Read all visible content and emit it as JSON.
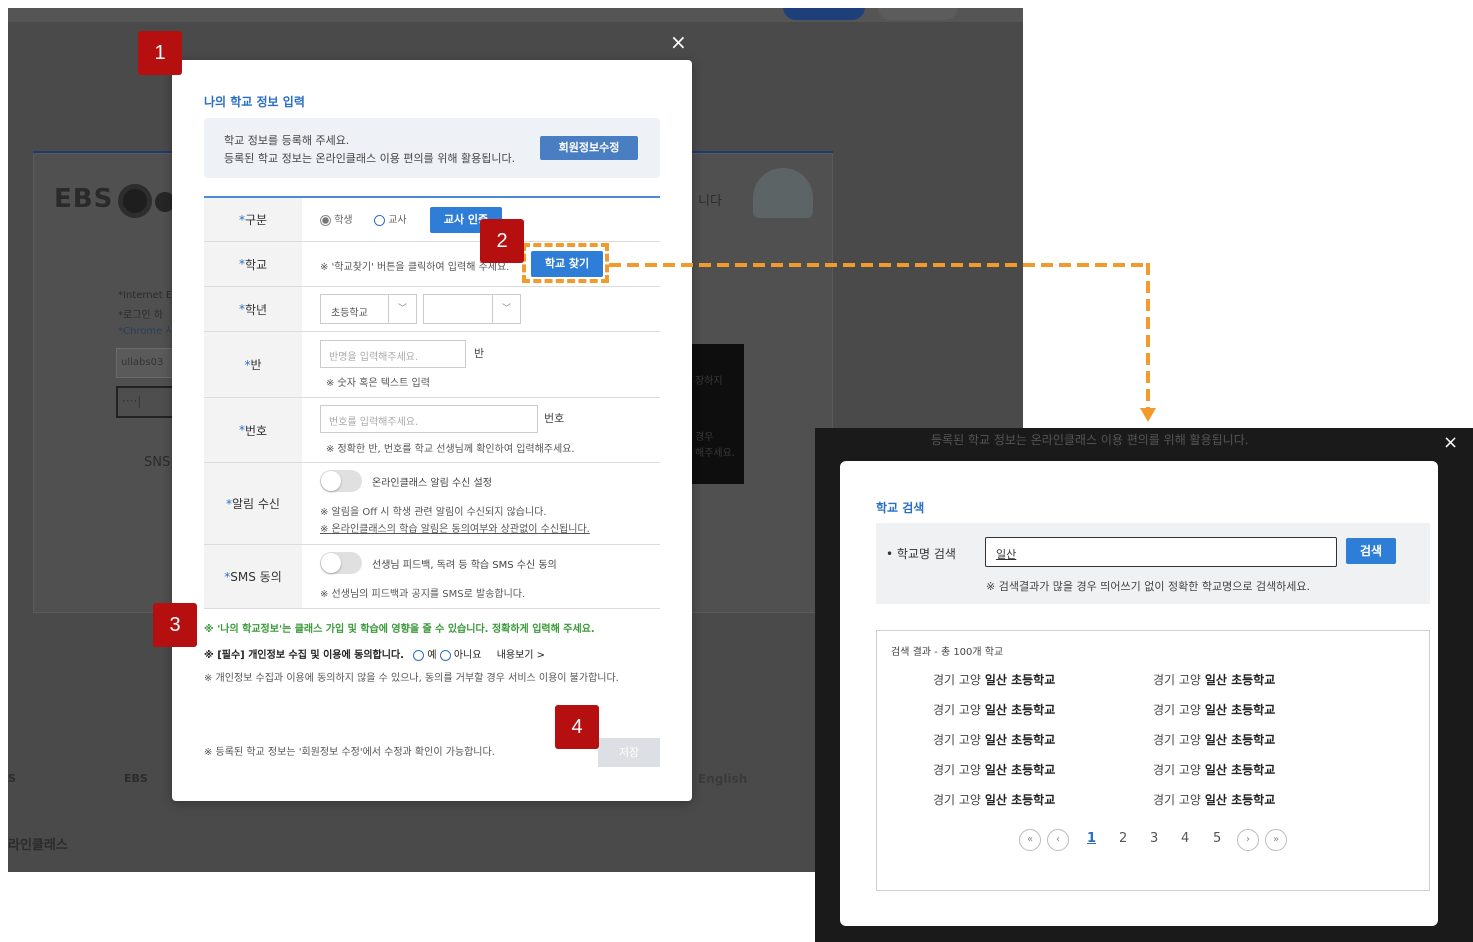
{
  "background": {
    "logo_text": "EBS",
    "banner_text": "니다",
    "notes": [
      "*Internet Ex",
      "*로그인 하",
      "*Chrome 사"
    ],
    "id_value": "ullabs03",
    "pw_value": "····|",
    "sns_label": "SNS",
    "blackbox_lines": [
      "장하지",
      "경우",
      "해주세요."
    ],
    "footer_logo_1": "S",
    "footer_logo_2": "EBS",
    "footer_english": "English",
    "footer_title": "라인클래스"
  },
  "main_modal": {
    "close": "×",
    "title": "나의 학교 정보 입력",
    "info_line1": "학교 정보를 등록해 주세요.",
    "info_line2": "등록된 학교 정보는 온라인클래스 이용 편의를 위해 활용됩니다.",
    "edit_member_button": "회원정보수정",
    "rows": {
      "type": {
        "label": "구분",
        "opt_student": "학생",
        "opt_teacher": "교사",
        "teacher_auth_button": "교사 인증"
      },
      "school": {
        "label": "학교",
        "hint": "※ '학교찾기' 버튼을 클릭하여 입력해 주세요.",
        "find_button": "학교 찾기"
      },
      "grade": {
        "label": "학년",
        "select1": "초등학교",
        "select2": ""
      },
      "class": {
        "label": "반",
        "placeholder": "반명을 입력해주세요.",
        "suffix": "반",
        "note": "※ 숫자 혹은 텍스트 입력"
      },
      "number": {
        "label": "번호",
        "placeholder": "번호를 입력해주세요.",
        "suffix": "번호",
        "note": "※ 정확한 반, 번호를 학교 선생님께 확인하여 입력해주세요."
      },
      "alert": {
        "label": "알림 수신",
        "toggle_label": "온라인클래스 알림 수신 설정",
        "note1": "※ 알림을 Off 시 학생 관련 알림이 수신되지 않습니다.",
        "note2": "※ 온라인클래스의 학습 알림은 동의여부와 상관없이 수신됩니다."
      },
      "sms": {
        "label": "SMS 동의",
        "toggle_label": "선생님 피드백, 독려 등 학습 SMS 수신 동의",
        "note": "※ 선생님의 피드백과 공지를 SMS로 발송합니다."
      }
    },
    "warning": "※ '나의 학교정보'는 클래스 가입 및 학습에 영향을 줄 수 있습니다. 정확하게 입력해 주세요.",
    "consent_label": "※ [필수] 개인정보 수집 및 이용에 동의합니다.",
    "consent_yes": "예",
    "consent_no": "아니요",
    "consent_view": "내용보기 >",
    "consent_note": "※ 개인정보 수집과 이용에 동의하지 않을 수 있으나, 동의를 거부할 경우 서비스 이용이 불가합니다.",
    "bottom_note": "※ 등록된 학교 정보는 '회원정보 수정'에서 수정과 확인이 가능합니다.",
    "save_button": "저장"
  },
  "badges": [
    "1",
    "2",
    "3",
    "4"
  ],
  "search_popup": {
    "dim_text": "등록된 학교 정보는 온라인클래스 이용 편의를 위해 활용됩니다.",
    "close": "×",
    "title": "학교 검색",
    "field_label": "• 학교명 검색",
    "field_value": "일산",
    "search_button": "검색",
    "hint": "※ 검색결과가 많을 경우 띄어쓰기 없이 정확한 학교명으로 검색하세요.",
    "results_header": "검색 결과 - 총 100개 학교",
    "result_prefix": "경기 고양",
    "result_name": "일산 초등학교",
    "results_count_per_col": 5,
    "pagination": {
      "first": "«",
      "prev": "‹",
      "pages": [
        "1",
        "2",
        "3",
        "4",
        "5"
      ],
      "current": "1",
      "next": "›",
      "last": "»"
    }
  },
  "colors": {
    "accent": "#2e7dd6",
    "badge": "#b50f0f",
    "arrow": "#f29a2b",
    "warning_green": "#3a9a3a"
  }
}
